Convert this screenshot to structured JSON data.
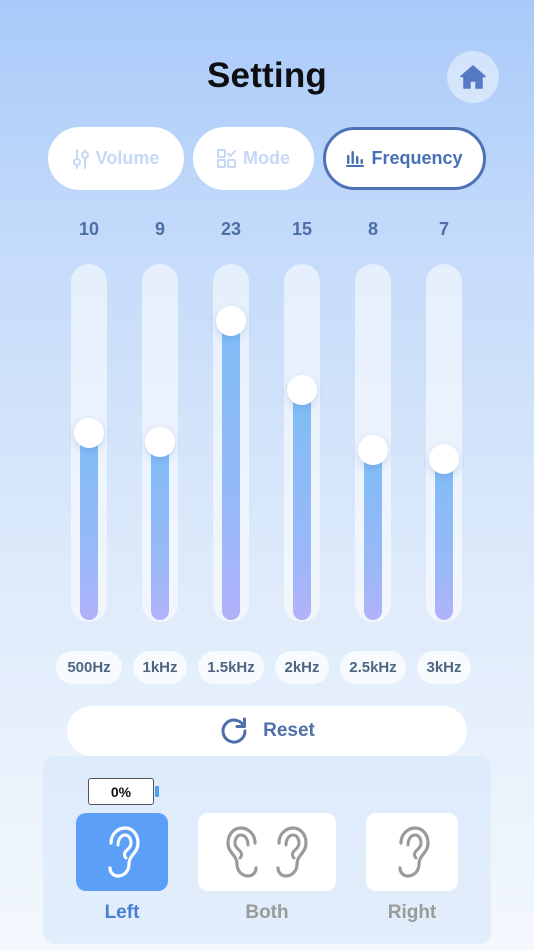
{
  "header": {
    "title": "Setting",
    "home_icon": "home-icon"
  },
  "tabs": [
    {
      "label": "Volume",
      "icon": "sliders-icon",
      "active": false
    },
    {
      "label": "Mode",
      "icon": "mode-grid-icon",
      "active": false
    },
    {
      "label": "Frequency",
      "icon": "bar-chart-icon",
      "active": true
    }
  ],
  "equalizer": {
    "level_max": 30,
    "bands": [
      {
        "value": "10",
        "level": 10,
        "label": "500Hz"
      },
      {
        "value": "9",
        "level": 9,
        "label": "1kHz"
      },
      {
        "value": "23",
        "level": 23,
        "label": "1.5kHz"
      },
      {
        "value": "15",
        "level": 15,
        "label": "2kHz"
      },
      {
        "value": "8",
        "level": 8,
        "label": "2.5kHz"
      },
      {
        "value": "7",
        "level": 7,
        "label": "3kHz"
      }
    ]
  },
  "reset": {
    "label": "Reset",
    "icon": "refresh-icon"
  },
  "battery": {
    "text": "0%"
  },
  "ear_select": [
    {
      "label": "Left",
      "icon": "left-ear-icon",
      "selected": true
    },
    {
      "label": "Both",
      "icon": "both-ears-icon",
      "selected": false
    },
    {
      "label": "Right",
      "icon": "right-ear-icon",
      "selected": false
    }
  ],
  "colors": {
    "accent": "#4d72b6",
    "selected_ear": "#5c9ff8",
    "value_text": "#4e6ea8"
  }
}
